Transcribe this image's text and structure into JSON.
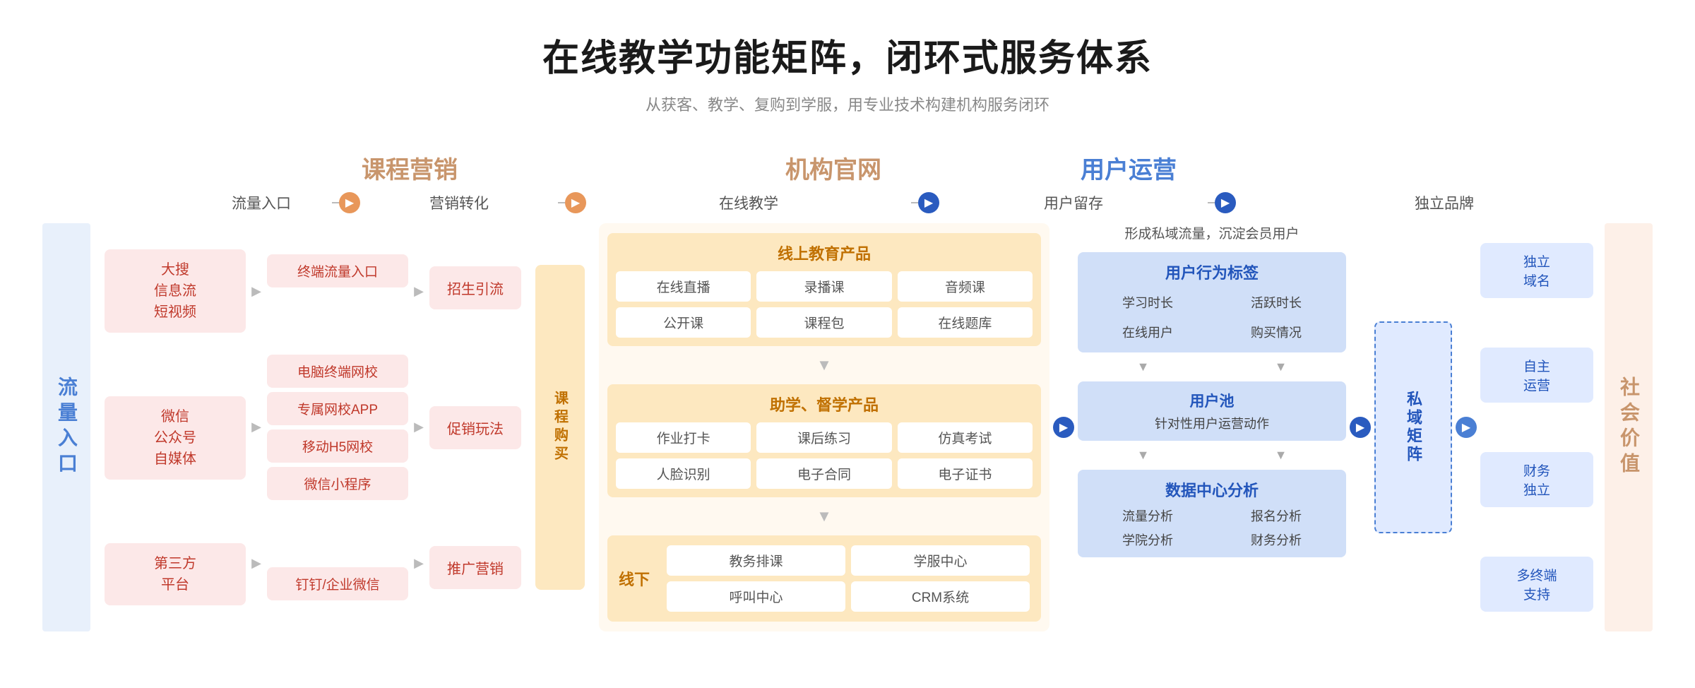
{
  "page": {
    "title": "在线教学功能矩阵，闭环式服务体系",
    "subtitle": "从获客、教学、复购到学服，用专业技术构建机构服务闭环"
  },
  "categories": {
    "marketing_label": "课程营销",
    "official_label": "机构官网",
    "user_ops_label": "用户运营"
  },
  "flow_stages": {
    "traffic_entry": "流量入口",
    "marketing_conversion": "营销转化",
    "online_teaching": "在线教学",
    "user_retention": "用户留存",
    "independent_brand": "独立品牌"
  },
  "left_label": "流量入口",
  "right_label": "社会价值",
  "traffic_sources": [
    {
      "label": "大搜\n信息流\n短视频"
    },
    {
      "label": "微信\n公众号\n自媒体"
    },
    {
      "label": "第三方\n平台"
    }
  ],
  "terminal_items": [
    {
      "label": "终端流量入口"
    },
    {
      "label": "电脑终端网校"
    },
    {
      "label": "专属网校APP"
    },
    {
      "label": "移动H5网校"
    },
    {
      "label": "微信小程序"
    },
    {
      "label": "钉钉/企业微信"
    }
  ],
  "conversion_items": [
    {
      "label": "招生引流"
    },
    {
      "label": "促销玩法"
    },
    {
      "label": "推广营销"
    }
  ],
  "course_buy_label": "课程购买",
  "online_education": {
    "section1_title": "线上教育产品",
    "items_row1": [
      "在线直播",
      "录播课",
      "音频课"
    ],
    "items_row2": [
      "公开课",
      "课程包",
      "在线题库"
    ],
    "section2_title": "助学、督学产品",
    "items_row3": [
      "作业打卡",
      "课后练习",
      "仿真考试"
    ],
    "items_row4": [
      "人脸识别",
      "电子合同",
      "电子证书"
    ]
  },
  "offline": {
    "label": "线下",
    "items": [
      "教务排课",
      "学服中心",
      "呼叫中心",
      "CRM系统"
    ]
  },
  "user_retention": {
    "top_text": "形成私域流量，沉淀会员用户",
    "behavior_tag_title": "用户行为标签",
    "behavior_items": [
      "学习时长",
      "活跃时长",
      "在线用户",
      "购买情况"
    ],
    "user_pool_title": "用户池",
    "user_pool_sub": "针对性用户运营动作",
    "data_center_title": "数据中心分析",
    "data_items": [
      "流量分析",
      "报名分析",
      "学院分析",
      "财务分析"
    ]
  },
  "private_domain": {
    "label": "私域矩阵"
  },
  "brand_items": [
    {
      "label": "独立\n域名"
    },
    {
      "label": "自主\n运营"
    },
    {
      "label": "财务\n独立"
    },
    {
      "label": "多终端\n支持"
    }
  ],
  "arrows": {
    "orange_arrow": "▶",
    "blue_arrow": "▶",
    "small_right": "▶",
    "small_down": "▼"
  }
}
